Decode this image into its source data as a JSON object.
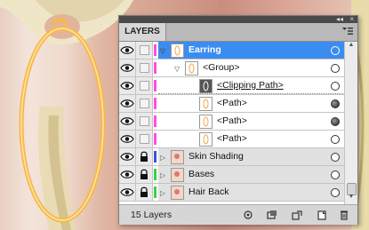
{
  "panel": {
    "tab_label": "LAYERS",
    "titlebar_collapse": "◂◂",
    "titlebar_close": "×",
    "menu_icon": "panel-menu-icon"
  },
  "layers": [
    {
      "name": "Earring",
      "level": 0,
      "expanded": true,
      "selected": true,
      "color": "#ff4fe0",
      "locked": false,
      "target": "hollow"
    },
    {
      "name": "<Group>",
      "level": 1,
      "expanded": true,
      "selected": false,
      "color": "#ff4fe0",
      "locked": false,
      "target": "hollow"
    },
    {
      "name": "<Clipping Path>",
      "level": 2,
      "expanded": false,
      "selected": false,
      "color": "#ff4fe0",
      "locked": false,
      "target": "hollow",
      "underline": true
    },
    {
      "name": "<Path>",
      "level": 2,
      "expanded": false,
      "selected": false,
      "color": "#ff4fe0",
      "locked": false,
      "target": "filled"
    },
    {
      "name": "<Path>",
      "level": 2,
      "expanded": false,
      "selected": false,
      "color": "#ff4fe0",
      "locked": false,
      "target": "filled"
    },
    {
      "name": "<Path>",
      "level": 2,
      "expanded": false,
      "selected": false,
      "color": "#ff4fe0",
      "locked": false,
      "target": "hollow"
    },
    {
      "name": "Skin Shading",
      "level": 0,
      "expanded": false,
      "selected": false,
      "color": "#3b4fe0",
      "locked": true,
      "target": "hollow"
    },
    {
      "name": "Bases",
      "level": 0,
      "expanded": false,
      "selected": false,
      "color": "#3bd048",
      "locked": true,
      "target": "hollow"
    },
    {
      "name": "Hair Back",
      "level": 0,
      "expanded": false,
      "selected": false,
      "color": "#3bd048",
      "locked": true,
      "target": "hollow"
    }
  ],
  "footer": {
    "count_label": "15 Layers",
    "buttons": [
      "locate-object-icon",
      "make-clipping-mask-icon",
      "new-sublayer-icon",
      "new-layer-icon",
      "delete-layer-icon"
    ]
  }
}
